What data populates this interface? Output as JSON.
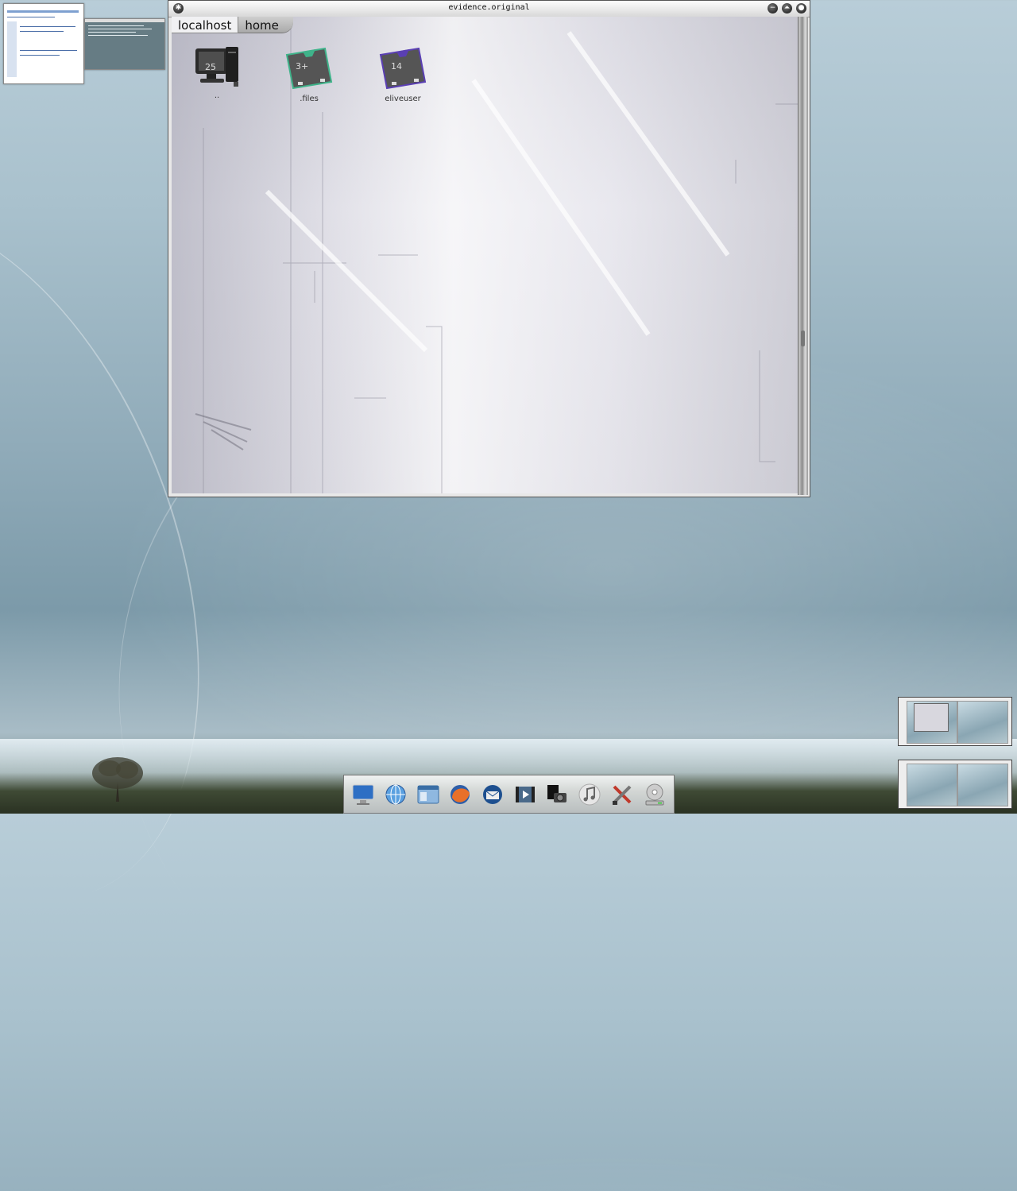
{
  "window": {
    "title": "evidence.original",
    "buttons": {
      "menu_icon": "star-icon",
      "minimize_icon": "minimize-icon",
      "shade_icon": "shade-icon",
      "close_icon": "close-icon"
    }
  },
  "breadcrumb": [
    {
      "label": "localhost"
    },
    {
      "label": "home"
    }
  ],
  "icons": [
    {
      "label": "..",
      "badge": "25",
      "icon": "computer-icon"
    },
    {
      "label": ".files",
      "badge": "3+",
      "icon": "folder-icon",
      "accent": "#3fb38a"
    },
    {
      "label": "eliveuser",
      "badge": "14",
      "icon": "folder-icon",
      "accent": "#5a3fb3"
    }
  ],
  "dock": [
    {
      "icon": "monitor-icon"
    },
    {
      "icon": "network-globe-icon"
    },
    {
      "icon": "file-manager-icon"
    },
    {
      "icon": "firefox-icon"
    },
    {
      "icon": "thunderbird-icon"
    },
    {
      "icon": "video-player-icon"
    },
    {
      "icon": "photo-camera-icon"
    },
    {
      "icon": "music-player-icon"
    },
    {
      "icon": "settings-tools-icon"
    },
    {
      "icon": "dvd-burner-icon"
    }
  ],
  "colors": {
    "desktop_sky": "#a9c1cd",
    "window_frame": "#e8e8e8",
    "titlebar": "#dcdcdc"
  }
}
